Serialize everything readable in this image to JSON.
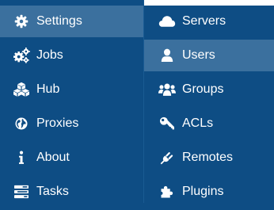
{
  "left_column": {
    "items": [
      {
        "label": "Settings",
        "icon": "gear-icon",
        "active": true
      },
      {
        "label": "Jobs",
        "icon": "gears-icon",
        "active": false
      },
      {
        "label": "Hub",
        "icon": "cubes-icon",
        "active": false
      },
      {
        "label": "Proxies",
        "icon": "globe-icon",
        "active": false
      },
      {
        "label": "About",
        "icon": "info-icon",
        "active": false
      },
      {
        "label": "Tasks",
        "icon": "tasks-icon",
        "active": false
      }
    ]
  },
  "right_column": {
    "items": [
      {
        "label": "Servers",
        "icon": "cloud-icon",
        "active": false
      },
      {
        "label": "Users",
        "icon": "user-icon",
        "active": true
      },
      {
        "label": "Groups",
        "icon": "users-group-icon",
        "active": false
      },
      {
        "label": "ACLs",
        "icon": "key-icon",
        "active": false
      },
      {
        "label": "Remotes",
        "icon": "plug-icon",
        "active": false
      },
      {
        "label": "Plugins",
        "icon": "puzzle-piece-icon",
        "active": false
      }
    ]
  },
  "colors": {
    "background": "#0e4d84",
    "active_background": "#3b709e",
    "text": "#ffffff"
  }
}
